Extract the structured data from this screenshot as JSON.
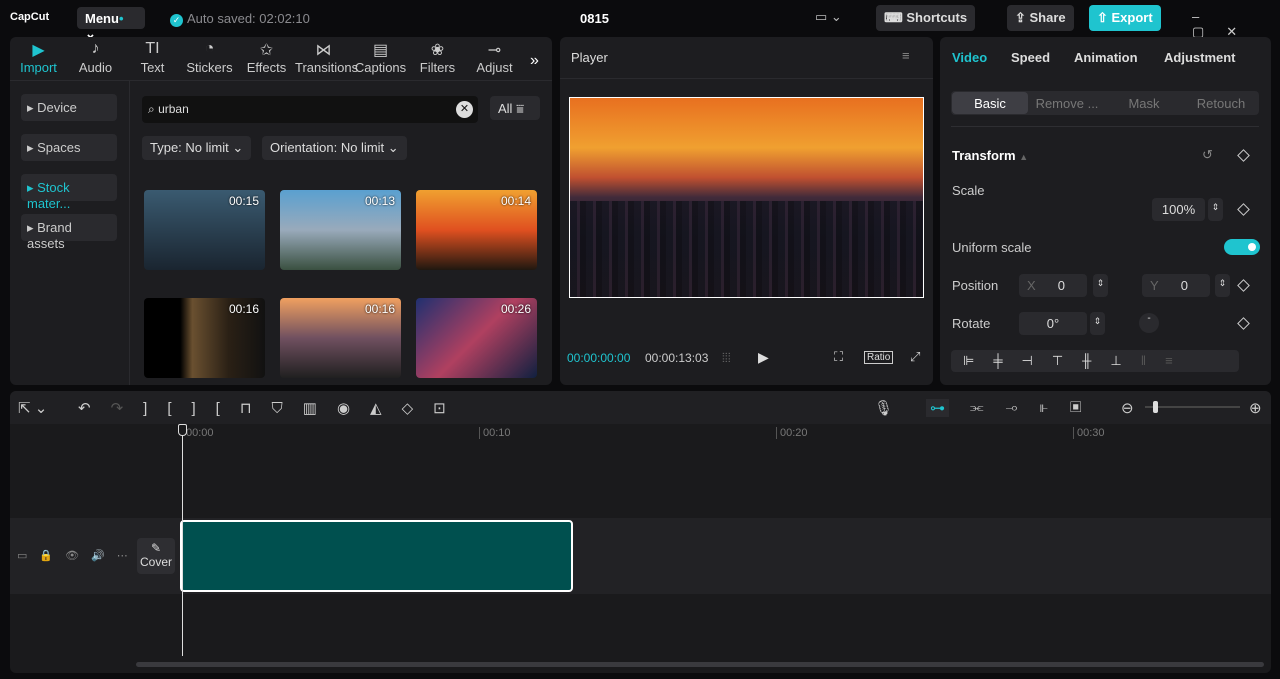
{
  "app": {
    "logo": "CapCut",
    "menu": "Menu",
    "autosave": "Auto saved: 02:02:10",
    "project": "0815",
    "shortcuts": "Shortcuts",
    "share": "Share",
    "export": "Export"
  },
  "media_tabs": [
    {
      "label": "Import",
      "icon": "▶"
    },
    {
      "label": "Audio",
      "icon": "♪"
    },
    {
      "label": "Text",
      "icon": "TI"
    },
    {
      "label": "Stickers",
      "icon": "◔"
    },
    {
      "label": "Effects",
      "icon": "✩"
    },
    {
      "label": "Transitions",
      "icon": "⋈"
    },
    {
      "label": "Captions",
      "icon": "▤"
    },
    {
      "label": "Filters",
      "icon": "❀"
    },
    {
      "label": "Adjust",
      "icon": "⊸"
    }
  ],
  "sidebar": [
    "Device",
    "Spaces",
    "Stock mater...",
    "Brand assets"
  ],
  "search": {
    "value": "urban",
    "filter": "All",
    "type": "Type: No limit",
    "orientation": "Orientation: No limit"
  },
  "thumbs": [
    {
      "d": "00:15",
      "bg": "linear-gradient(#3a5a70,#1a2530)"
    },
    {
      "d": "00:13",
      "bg": "linear-gradient(#5aa0d0,#9ab 50%,#3a5040)"
    },
    {
      "d": "00:14",
      "bg": "linear-gradient(#f0a030,#e05020 50%,#201810)"
    },
    {
      "d": "00:16",
      "bg": "linear-gradient(90deg,#000 30%,#6a5030 40%,#2a2015 70%,#111)"
    },
    {
      "d": "00:16",
      "bg": "linear-gradient(#f0a060,#705060 50%,#202020)"
    },
    {
      "d": "00:26",
      "bg": "linear-gradient(135deg,#203070,#b04060 50%,#102040)"
    }
  ],
  "player": {
    "title": "Player",
    "current": "00:00:00:00",
    "total": "00:00:13:03",
    "ratio": "Ratio"
  },
  "props": {
    "tabs": [
      "Video",
      "Speed",
      "Animation",
      "Adjustment"
    ],
    "subtabs": [
      "Basic",
      "Remove ...",
      "Mask",
      "Retouch"
    ],
    "section": "Transform",
    "scale_label": "Scale",
    "scale": "100%",
    "uniform": "Uniform scale",
    "uniform_on": true,
    "position": "Position",
    "x_label": "X",
    "x": "0",
    "y_label": "Y",
    "y": "0",
    "rotate": "Rotate",
    "rotate_val": "0°"
  },
  "timeline": {
    "ticks": [
      "00:00",
      "00:10",
      "00:20",
      "00:30"
    ],
    "cover": "Cover"
  },
  "colors": {
    "accent": "#1fc4cf",
    "clip": "#00504f"
  }
}
